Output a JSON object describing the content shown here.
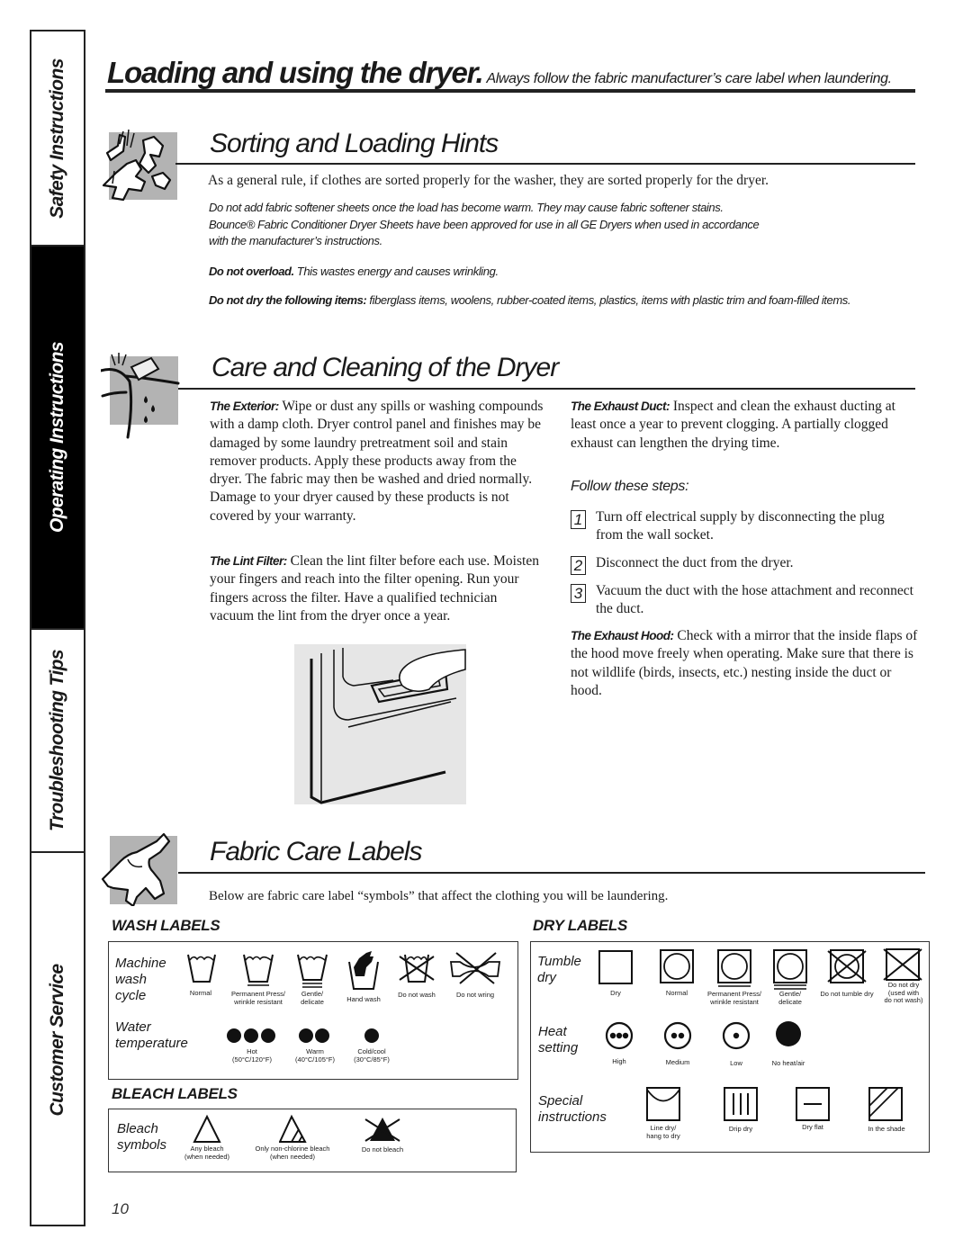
{
  "sidebar": {
    "tabs": [
      {
        "label": "Safety Instructions",
        "active": false
      },
      {
        "label": "Operating Instructions",
        "active": true
      },
      {
        "label": "Troubleshooting Tips",
        "active": false
      },
      {
        "label": "Customer Service",
        "active": false
      }
    ]
  },
  "header": {
    "title": "Loading and using the dryer.",
    "subtitle": "Always follow the fabric manufacturer’s care label when laundering."
  },
  "sorting": {
    "title": "Sorting and Loading Hints",
    "icon": "tumbling-clothes-icon",
    "intro": "As a general rule, if clothes are sorted properly for the washer, they are sorted properly for the dryer.",
    "note_line1": "Do not add fabric softener sheets once the load has become warm. They may cause fabric softener stains.",
    "note_line2": "Bounce® Fabric Conditioner Dryer Sheets have been approved for use in all GE Dryers when used in accordance",
    "note_line3": "with the manufacturer’s instructions.",
    "overload_lead": "Do not overload.",
    "overload_text": " This wastes energy and causes wrinkling.",
    "items_lead": "Do not dry the following items:",
    "items_text": " fiberglass items, woolens, rubber-coated items, plastics, items with plastic trim and foam-filled items."
  },
  "care": {
    "title": "Care and Cleaning of the Dryer",
    "icon": "sponge-cleaning-icon",
    "exterior_lead": "The Exterior:",
    "exterior_text": " Wipe or dust any spills or washing compounds with a damp cloth. Dryer control panel and finishes may be damaged by some laundry pretreatment soil and stain remover products. Apply these products away from the dryer. The fabric may then be washed and dried normally. Damage to your dryer caused by these products is not covered by your warranty.",
    "lint_lead": "The Lint Filter:",
    "lint_text": " Clean the lint filter before each use. Moisten your fingers and reach into the filter opening. Run your fingers across the filter. Have a qualified technician vacuum the lint from the dryer once a year.",
    "illustration": "lint-filter-illustration",
    "duct_lead": "The Exhaust Duct:",
    "duct_text": " Inspect and clean the exhaust ducting at least once a year to prevent clogging. A partially clogged exhaust can lengthen the drying time.",
    "steps_heading": "Follow these steps:",
    "steps": [
      {
        "num": "1",
        "text": "Turn off electrical supply by disconnecting the plug from the wall socket."
      },
      {
        "num": "2",
        "text": "Disconnect the duct from the dryer."
      },
      {
        "num": "3",
        "text": "Vacuum the duct with the hose attachment and reconnect the duct."
      }
    ],
    "hood_lead": "The Exhaust Hood:",
    "hood_text": " Check with a mirror that the inside flaps of the hood move freely when operating. Make sure that there is not wildlife (birds, insects, etc.) nesting inside the duct or hood."
  },
  "fabric": {
    "title": "Fabric Care Labels",
    "icon": "shirt-icon",
    "intro": "Below are fabric care label “symbols” that affect the clothing you will be laundering."
  },
  "wash_labels": {
    "heading": "WASH LABELS",
    "cycle_label": [
      "Machine",
      "wash",
      "cycle"
    ],
    "cycle": [
      {
        "icon": "washtub-icon",
        "caption": [
          "Normal"
        ]
      },
      {
        "icon": "washtub-permanent-press-icon",
        "caption": [
          "Permanent Press/",
          "wrinkle resistant"
        ]
      },
      {
        "icon": "washtub-gentle-icon",
        "caption": [
          "Gentle/",
          "delicate"
        ]
      },
      {
        "icon": "hand-wash-icon",
        "caption": [
          "Hand wash"
        ]
      },
      {
        "icon": "do-not-wash-icon",
        "caption": [
          "Do not wash"
        ]
      },
      {
        "icon": "do-not-wring-icon",
        "caption": [
          "Do not wring"
        ]
      }
    ],
    "temp_label": [
      "Water",
      "temperature"
    ],
    "temps": [
      {
        "dots": 3,
        "caption": [
          "Hot",
          "(50°C/120°F)"
        ]
      },
      {
        "dots": 2,
        "caption": [
          "Warm",
          "(40°C/105°F)"
        ]
      },
      {
        "dots": 1,
        "caption": [
          "Cold/cool",
          "(30°C/85°F)"
        ]
      }
    ]
  },
  "bleach_labels": {
    "heading": "BLEACH LABELS",
    "row_label": [
      "Bleach",
      "symbols"
    ],
    "items": [
      {
        "icon": "any-bleach-icon",
        "caption": [
          "Any bleach",
          "(when needed)"
        ]
      },
      {
        "icon": "non-chlorine-bleach-icon",
        "caption": [
          "Only non-chlorine bleach",
          "(when needed)"
        ]
      },
      {
        "icon": "do-not-bleach-icon",
        "caption": [
          "Do not bleach"
        ]
      }
    ]
  },
  "dry_labels": {
    "heading": "DRY LABELS",
    "tumble_label": [
      "Tumble",
      "dry"
    ],
    "tumble": [
      {
        "icon": "tumble-dry-square-icon",
        "caption": [
          "Dry"
        ]
      },
      {
        "icon": "tumble-normal-icon",
        "caption": [
          "Normal"
        ]
      },
      {
        "icon": "tumble-permanent-press-icon",
        "caption": [
          "Permanent Press/",
          "wrinkle resistant"
        ]
      },
      {
        "icon": "tumble-gentle-icon",
        "caption": [
          "Gentle/",
          "delicate"
        ]
      },
      {
        "icon": "do-not-tumble-dry-icon",
        "caption": [
          "Do not tumble dry"
        ]
      },
      {
        "icon": "do-not-dry-icon",
        "caption": [
          "Do not dry",
          "(used with",
          "do not wash)"
        ]
      }
    ],
    "heat_label": [
      "Heat",
      "setting"
    ],
    "heat": [
      {
        "icon": "heat-high-icon",
        "caption": [
          "High"
        ]
      },
      {
        "icon": "heat-medium-icon",
        "caption": [
          "Medium"
        ]
      },
      {
        "icon": "heat-low-icon",
        "caption": [
          "Low"
        ]
      },
      {
        "icon": "no-heat-icon",
        "caption": [
          "No heat/air"
        ]
      }
    ],
    "special_label": [
      "Special",
      "instructions"
    ],
    "special": [
      {
        "icon": "line-dry-icon",
        "caption": [
          "Line dry/",
          "hang to dry"
        ]
      },
      {
        "icon": "drip-dry-icon",
        "caption": [
          "Drip dry"
        ]
      },
      {
        "icon": "dry-flat-icon",
        "caption": [
          "Dry flat"
        ]
      },
      {
        "icon": "in-the-shade-icon",
        "caption": [
          "In the shade"
        ]
      }
    ]
  },
  "footer": {
    "page_number": "10"
  }
}
